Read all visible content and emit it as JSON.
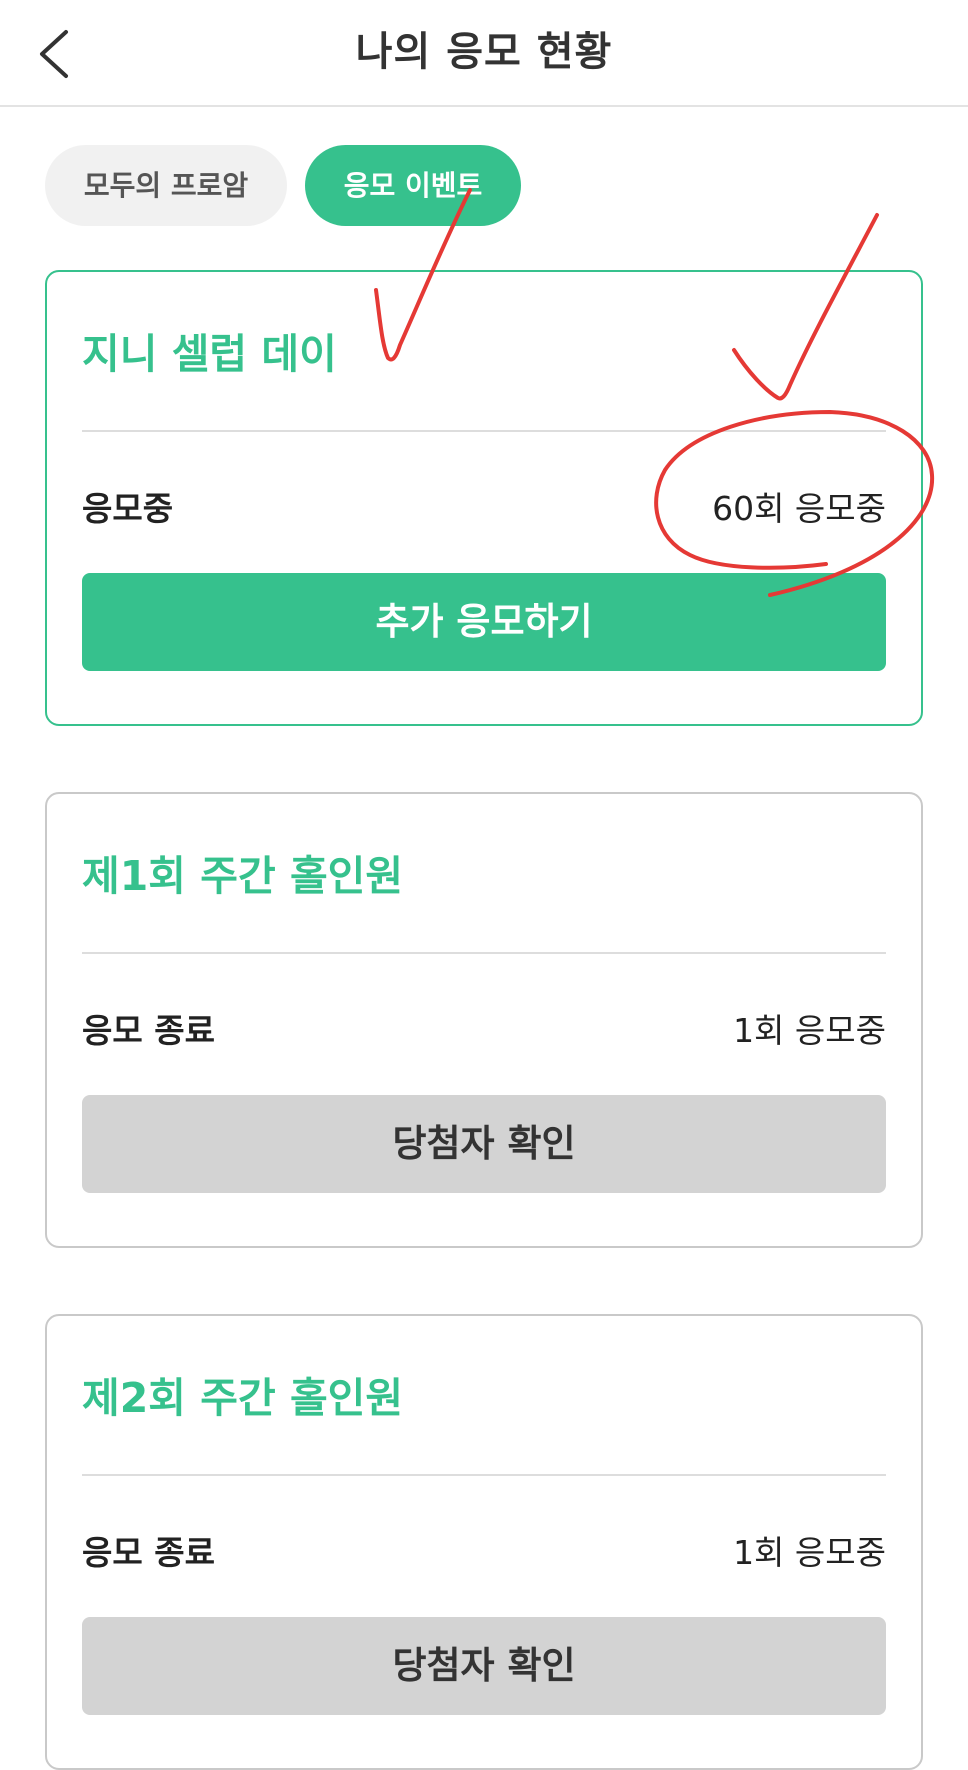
{
  "header": {
    "title": "나의 응모 현황",
    "back_icon": "chevron-left-icon"
  },
  "tabs": [
    {
      "label": "모두의 프로암",
      "active": false
    },
    {
      "label": "응모 이벤트",
      "active": true
    }
  ],
  "cards": [
    {
      "title": "지니 셀럽 데이",
      "status": "응모중",
      "count": "60회 응모중",
      "button": "추가 응모하기",
      "active": true
    },
    {
      "title": "제1회 주간 홀인원",
      "status": "응모 종료",
      "count": "1회 응모중",
      "button": "당첨자 확인",
      "active": false
    },
    {
      "title": "제2회 주간 홀인원",
      "status": "응모 종료",
      "count": "1회 응모중",
      "button": "당첨자 확인",
      "active": false
    }
  ],
  "colors": {
    "accent": "#36c18d",
    "inactive_button": "#d3d3d3",
    "annotation": "#e53935"
  }
}
